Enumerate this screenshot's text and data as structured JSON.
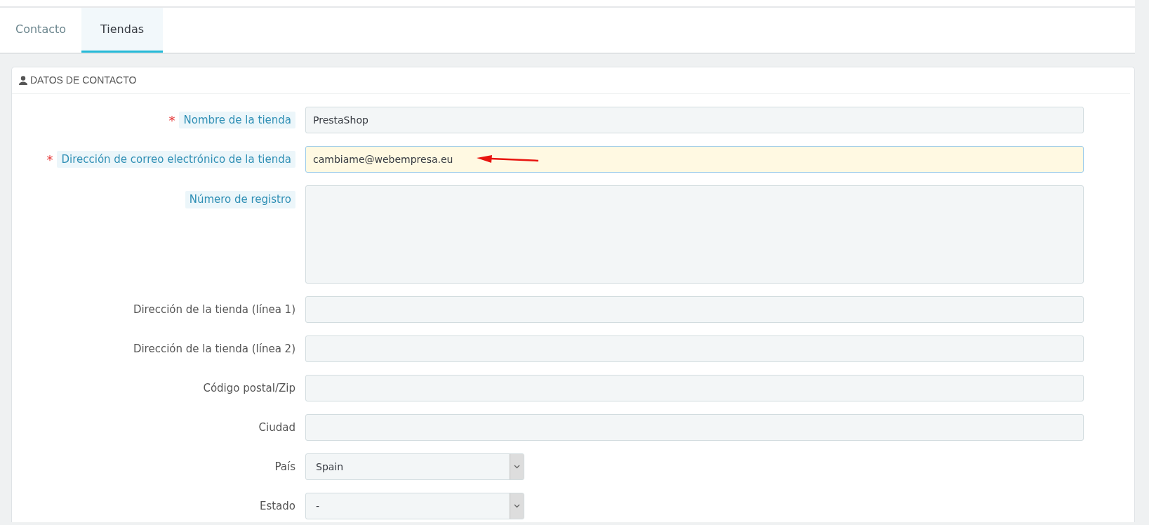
{
  "tabs": [
    {
      "label": "Contacto",
      "selected": false
    },
    {
      "label": "Tiendas",
      "selected": true
    }
  ],
  "panel": {
    "title": "DATOS DE CONTACTO"
  },
  "fields": [
    {
      "kind": "text",
      "label": "Nombre de la tienda",
      "required_mark": "*",
      "hint_label": true,
      "value": "PrestaShop",
      "focused": false
    },
    {
      "kind": "text",
      "label": "Dirección de correo electrónico de la tienda",
      "required_mark": "*",
      "hint_label": true,
      "value": "cambiame@webempresa.eu",
      "focused": true,
      "arrow": true
    },
    {
      "kind": "textarea",
      "label": "Número de registro",
      "hint_label": true,
      "focused": false
    },
    {
      "kind": "text",
      "label": "Dirección de la tienda (línea 1)",
      "hint_label": false,
      "focused": false
    },
    {
      "kind": "text",
      "label": "Dirección de la tienda (línea 2)",
      "hint_label": false,
      "focused": false
    },
    {
      "kind": "text",
      "label": "Código postal/Zip",
      "hint_label": false,
      "focused": false
    },
    {
      "kind": "text",
      "label": "Ciudad",
      "hint_label": false,
      "focused": false
    },
    {
      "kind": "select",
      "label": "País",
      "hint_label": false,
      "value": "Spain",
      "focused": false
    },
    {
      "kind": "select",
      "label": "Estado",
      "hint_label": false,
      "value": "-",
      "focused": false
    }
  ]
}
